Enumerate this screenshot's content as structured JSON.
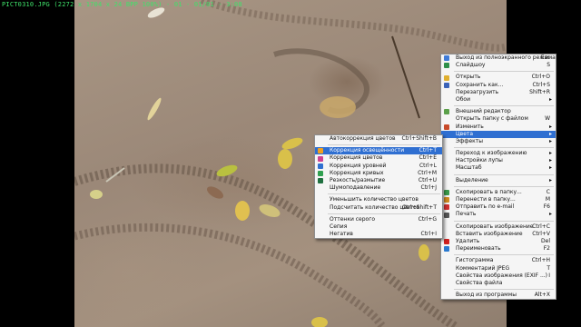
{
  "status_text": "PICT0310.JPG (2272 x 1704 x 24 BPP 100%) - 01 - 01/01 - 3:08",
  "main_menu": {
    "items": [
      {
        "label": "Выход из полноэкранного режима",
        "shortcut": "Esc",
        "icon": "fullscreen-exit-icon"
      },
      {
        "label": "Слайдшоу",
        "shortcut": "S",
        "icon": "slideshow-icon"
      },
      {
        "sep": true
      },
      {
        "label": "Открыть",
        "shortcut": "Ctrl+O",
        "icon": "folder-icon"
      },
      {
        "label": "Сохранить как...",
        "shortcut": "Ctrl+S",
        "icon": "save-icon"
      },
      {
        "label": "Перезагрузить",
        "shortcut": "Shift+R"
      },
      {
        "label": "Обои",
        "arrow": true
      },
      {
        "sep": true
      },
      {
        "label": "Внешний редактор",
        "icon": "external-editor-icon"
      },
      {
        "label": "Открыть папку с файлом",
        "shortcut": "W"
      },
      {
        "label": "Изменить",
        "arrow": true,
        "icon": "edit-icon"
      },
      {
        "label": "Цвета",
        "arrow": true,
        "highlight": true
      },
      {
        "label": "Эффекты",
        "arrow": true
      },
      {
        "sep": true
      },
      {
        "label": "Переход к изображению",
        "arrow": true
      },
      {
        "label": "Настройки лупы",
        "arrow": true
      },
      {
        "label": "Масштаб",
        "arrow": true
      },
      {
        "sep": true
      },
      {
        "label": "Выделение",
        "arrow": true
      },
      {
        "sep": true
      },
      {
        "label": "Скопировать в папку...",
        "shortcut": "C",
        "icon": "copy-folder-icon"
      },
      {
        "label": "Перенести в папку...",
        "shortcut": "M",
        "icon": "move-folder-icon"
      },
      {
        "label": "Отправить по e-mail",
        "shortcut": "F6",
        "icon": "email-icon"
      },
      {
        "label": "Печать",
        "arrow": true,
        "icon": "print-icon"
      },
      {
        "sep": true
      },
      {
        "label": "Скопировать изображение",
        "shortcut": "Ctrl+C"
      },
      {
        "label": "Вставить изображение",
        "shortcut": "Ctrl+V"
      },
      {
        "label": "Удалить",
        "shortcut": "Del",
        "icon": "delete-icon"
      },
      {
        "label": "Переименовать",
        "shortcut": "F2",
        "icon": "rename-icon"
      },
      {
        "sep": true
      },
      {
        "label": "Гистограмма",
        "shortcut": "Ctrl+H"
      },
      {
        "label": "Комментарий JPEG",
        "shortcut": "T"
      },
      {
        "label": "Свойства изображения (EXIF ...)",
        "shortcut": "I"
      },
      {
        "label": "Свойства файла"
      },
      {
        "sep": true
      },
      {
        "label": "Выход из программы",
        "shortcut": "Alt+X"
      }
    ]
  },
  "colors_menu": {
    "items": [
      {
        "label": "Автокоррекция цветов",
        "shortcut": "Ctrl+Shift+B"
      },
      {
        "sep": true
      },
      {
        "label": "Коррекция освещённости",
        "shortcut": "Ctrl+T",
        "highlight": true,
        "icon": "brightness-icon"
      },
      {
        "label": "Коррекция цветов",
        "shortcut": "Ctrl+E",
        "icon": "color-correction-icon"
      },
      {
        "label": "Коррекция уровней",
        "shortcut": "Ctrl+L",
        "icon": "levels-icon"
      },
      {
        "label": "Коррекция кривых",
        "shortcut": "Ctrl+M",
        "icon": "curves-icon"
      },
      {
        "label": "Резкость/размытие",
        "shortcut": "Ctrl+U",
        "icon": "sharpen-icon"
      },
      {
        "label": "Шумоподавление",
        "shortcut": "Ctrl+J"
      },
      {
        "sep": true
      },
      {
        "label": "Уменьшить количество цветов",
        "shortcut": ""
      },
      {
        "label": "Подсчитать количество цветов",
        "shortcut": "Ctrl+Shift+T"
      },
      {
        "sep": true
      },
      {
        "label": "Оттенки серого",
        "shortcut": "Ctrl+G"
      },
      {
        "label": "Сепия"
      },
      {
        "label": "Негатив",
        "shortcut": "Ctrl+I"
      }
    ]
  },
  "icon_colors": {
    "fullscreen-exit-icon": "#3f7bd8",
    "slideshow-icon": "#2e8f4a",
    "folder-icon": "#e0b030",
    "save-icon": "#3b63b8",
    "external-editor-icon": "#5aa04a",
    "edit-icon": "#c84a2a",
    "copy-folder-icon": "#3a9a4a",
    "move-folder-icon": "#d08a20",
    "email-icon": "#d03030",
    "print-icon": "#555555",
    "delete-icon": "#d02020",
    "rename-icon": "#2a7ad0",
    "brightness-icon": "#f0a020",
    "color-correction-icon": "#d04090",
    "levels-icon": "#3070d0",
    "curves-icon": "#30a050",
    "sharpen-icon": "#207040"
  }
}
